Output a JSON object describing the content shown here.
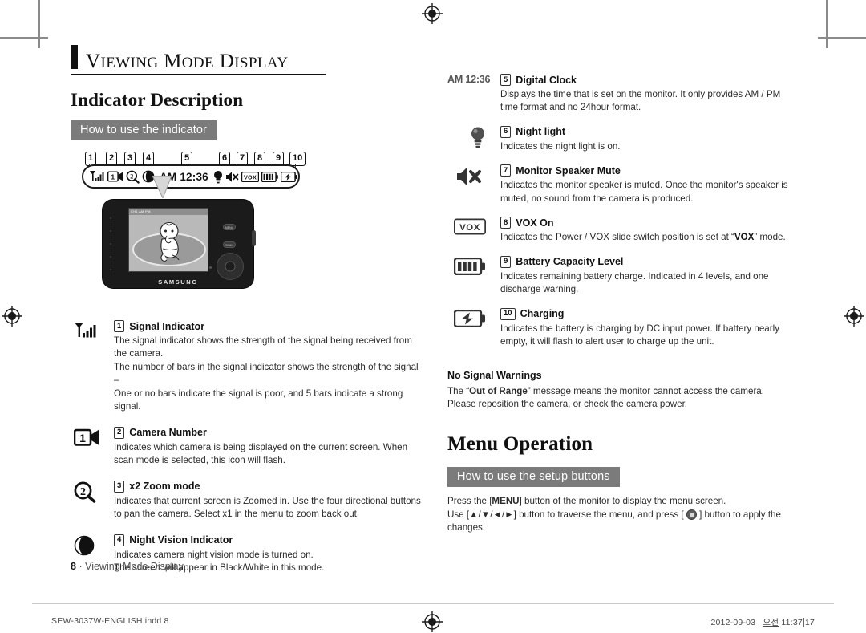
{
  "chapter": {
    "title_word1": "Viewing",
    "title_word2": "Mode",
    "title_word3": "Display"
  },
  "left": {
    "section_heading": "Indicator Description",
    "banner": "How to use the indicator",
    "callout_numbers": [
      "1",
      "2",
      "3",
      "4",
      "5",
      "6",
      "7",
      "8",
      "9",
      "10"
    ],
    "osd_clock": "AM 12:36",
    "device_brand": "SAMSUNG",
    "device_osd_text": "CH1  AM PM",
    "device_buttons": [
      "MENU",
      "SCAN"
    ],
    "entries": [
      {
        "num": "1",
        "icon": "signal-bars-icon",
        "title": "Signal Indicator",
        "body": "The signal indicator shows the strength of the signal being received from the camera.\nThe number of bars in the signal indicator shows the strength of the signal –\nOne or no bars indicate the signal is poor, and 5 bars indicate a strong signal."
      },
      {
        "num": "2",
        "icon": "camera-number-icon",
        "title": "Camera Number",
        "body": "Indicates which camera is being displayed on the current screen. When scan mode is selected, this icon will flash."
      },
      {
        "num": "3",
        "icon": "zoom-x2-icon",
        "title": "x2 Zoom mode",
        "body": "Indicates that current screen is Zoomed in. Use the four directional buttons to pan the camera. Select x1 in the menu to zoom back out."
      },
      {
        "num": "4",
        "icon": "night-vision-moon-icon",
        "title": "Night Vision Indicator",
        "body": "Indicates camera night vision mode is turned on.\nThe screen will appear in Black/White in this mode."
      }
    ]
  },
  "right": {
    "entries": [
      {
        "num": "5",
        "icon": "digital-clock-icon",
        "icon_text": "AM 12:36",
        "title": "Digital Clock",
        "body": "Displays the time that is set on the monitor. It only provides AM / PM time format and no 24hour format."
      },
      {
        "num": "6",
        "icon": "night-light-bulb-icon",
        "title": "Night light",
        "body": "Indicates the night light is on."
      },
      {
        "num": "7",
        "icon": "speaker-mute-icon",
        "title": "Monitor Speaker Mute",
        "body": "Indicates the monitor speaker is muted. Once the monitor's speaker is muted, no sound from the camera is produced."
      },
      {
        "num": "8",
        "icon": "vox-icon",
        "icon_text": "VOX",
        "title": "VOX On",
        "body_pre": "Indicates the Power / VOX slide switch position is set at “",
        "body_bold": "VOX",
        "body_post": "” mode."
      },
      {
        "num": "9",
        "icon": "battery-level-icon",
        "title": "Battery Capacity Level",
        "body": "Indicates remaining battery charge. Indicated in 4 levels, and one discharge warning."
      },
      {
        "num": "10",
        "icon": "battery-charging-icon",
        "title": "Charging",
        "body": "Indicates the battery is charging by DC input power. If battery nearly empty, it will flash to alert user to charge up the unit."
      }
    ],
    "no_signal": {
      "heading": "No Signal Warnings",
      "line1_pre": "The “",
      "line1_bold": "Out of Range",
      "line1_post": "” message means the monitor cannot access the camera.",
      "line2": "Please reposition the camera, or check the camera power."
    },
    "menu_operation": {
      "heading": "Menu Operation",
      "banner": "How to use the setup buttons",
      "line1": "Press the [MENU] button of the monitor to display the menu screen.",
      "line1_pre": "Press the [",
      "line1_bold": "MENU",
      "line1_post": "] button of the monitor to display the menu screen.",
      "line2_pre": "Use [▲/▼/◄/►] button to traverse the menu, and press [ ",
      "line2_post": " ] button to apply the changes."
    }
  },
  "footer": {
    "page_number": "8",
    "separator": "·",
    "section_name": "Viewing Mode Display",
    "print_file": "SEW‐3037W‐ENGLISH.indd   8",
    "print_date": "2012‐09‐03",
    "print_locale": "오전",
    "print_time": "11:37",
    "print_time_sec": "17"
  }
}
